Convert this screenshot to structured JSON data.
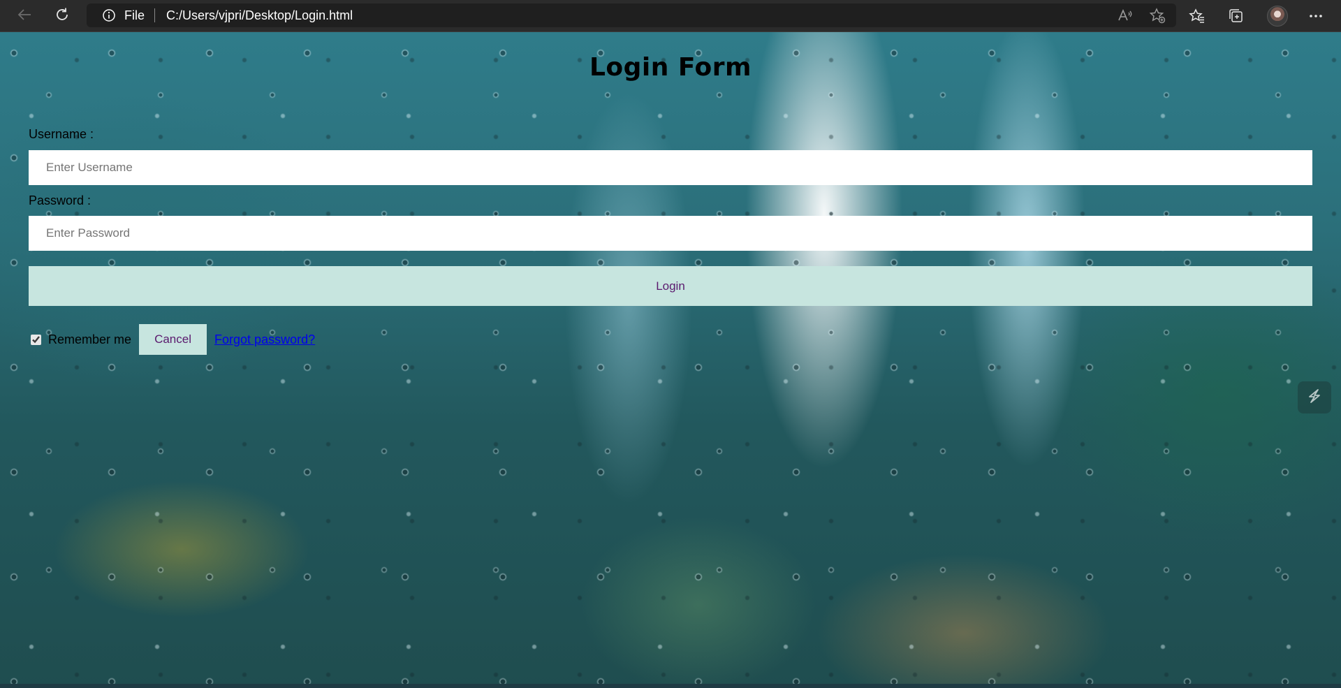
{
  "browser": {
    "file_label": "File",
    "url": "C:/Users/vjpri/Desktop/Login.html",
    "icons": [
      "back-arrow-icon",
      "reload-icon",
      "info-icon",
      "read-aloud-icon",
      "add-favorite-icon",
      "favorites-icon",
      "collections-icon",
      "profile-avatar",
      "more-options-icon"
    ]
  },
  "form": {
    "title": "Login Form",
    "username_label": "Username :",
    "username_placeholder": "Enter Username",
    "password_label": "Password :",
    "password_placeholder": "Enter Password",
    "login_label": "Login",
    "remember_label": "Remember me",
    "remember_checked": true,
    "cancel_label": "Cancel",
    "forgot_label": "Forgot password?"
  },
  "colors": {
    "button_bg": "#c7e5df",
    "button_text": "#5b1a6e",
    "link": "#0000ee",
    "browser_chrome": "#2b2b2b"
  }
}
